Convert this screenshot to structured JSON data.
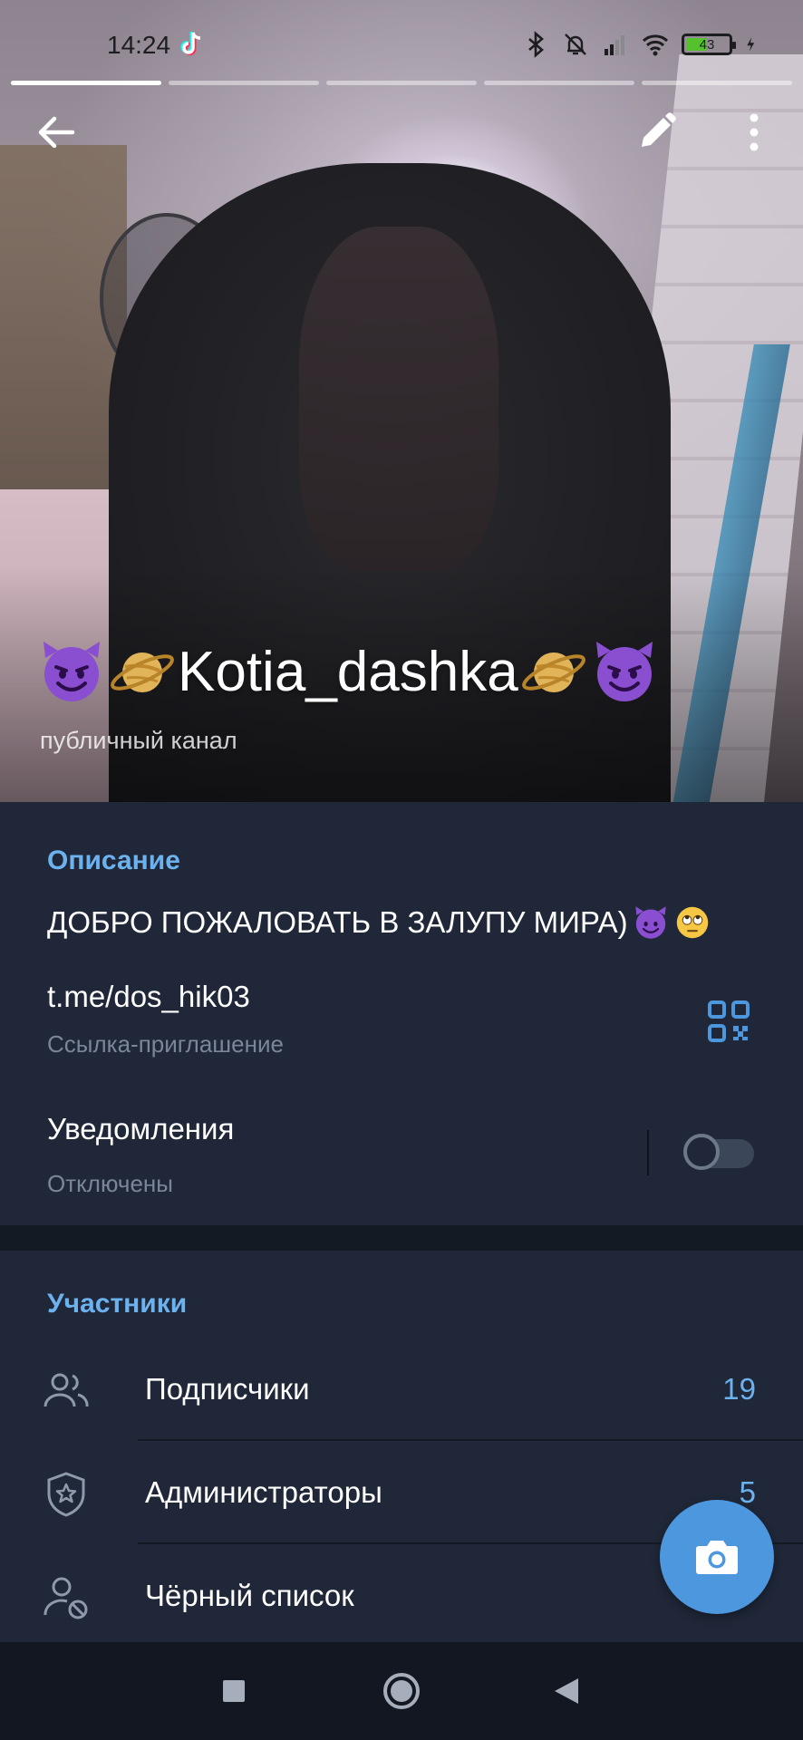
{
  "status_bar": {
    "time": "14:24",
    "battery_level": "43",
    "icons": [
      "tiktok-icon",
      "bluetooth-icon",
      "mute-icon",
      "signal-icon",
      "wifi-icon",
      "battery-icon",
      "charging-icon"
    ]
  },
  "story": {
    "segments_total": 5,
    "active_segment": 1
  },
  "toolbar": {
    "icons": [
      "back-arrow-icon",
      "edit-pencil-icon",
      "more-vertical-icon"
    ]
  },
  "channel": {
    "name": "Kotia_dashka",
    "subtitle": "публичный канал",
    "name_emojis": [
      "smiling-devil-emoji",
      "ringed-planet-emoji",
      "ringed-planet-emoji",
      "smiling-devil-emoji"
    ]
  },
  "info": {
    "description_header": "Описание",
    "description_text": "ДОБРО ПОЖАЛОВАТЬ В ЗАЛУПУ МИРА)",
    "description_emojis": [
      "smiling-devil-emoji",
      "eye-roll-emoji"
    ],
    "link_text": "t.me/dos_hik03",
    "link_sub": "Ссылка-приглашение",
    "notifications_title": "Уведомления",
    "notifications_sub": "Отключены",
    "notifications_enabled": false
  },
  "members": {
    "header": "Участники",
    "rows": [
      {
        "label": "Подписчики",
        "count": "19",
        "icon": "subscribers-icon"
      },
      {
        "label": "Администраторы",
        "count": "5",
        "icon": "admin-shield-icon"
      },
      {
        "label": "Чёрный список",
        "count": "",
        "icon": "blocked-user-icon"
      }
    ]
  },
  "colors": {
    "accent": "#6cb2ee",
    "panel": "#1f2738",
    "fab": "#4d97df",
    "nav": "#121722"
  },
  "navbar": {
    "icons": [
      "recents-square-icon",
      "home-circle-icon",
      "back-triangle-icon"
    ]
  }
}
